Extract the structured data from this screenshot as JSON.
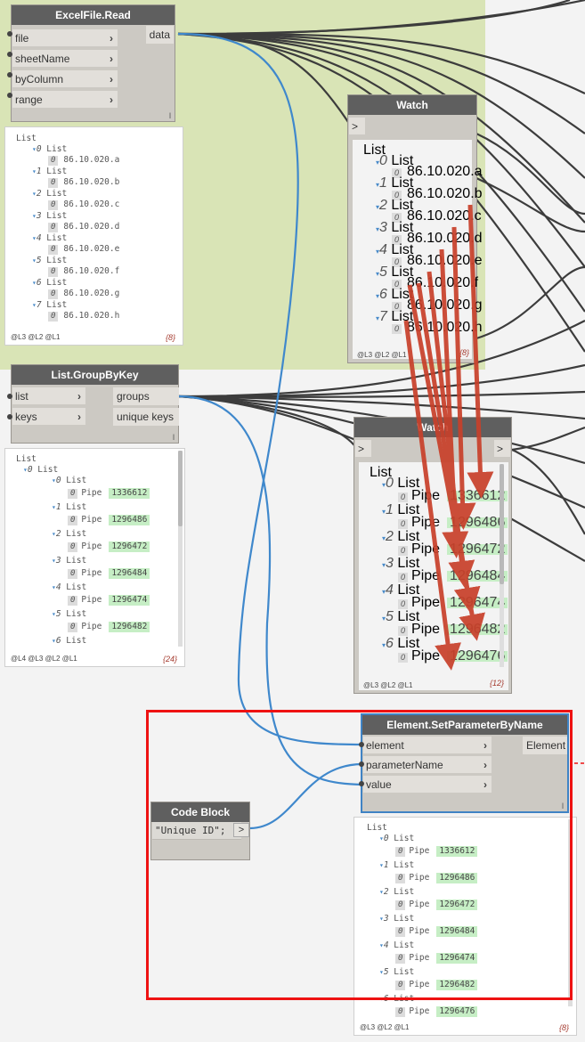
{
  "nodes": {
    "excel": {
      "title": "ExcelFile.Read",
      "inputs": [
        "file",
        "sheetName",
        "byColumn",
        "range"
      ],
      "output": "data",
      "lacing": "l"
    },
    "watch1": {
      "title": "Watch",
      "port": ">"
    },
    "group_by_key": {
      "title": "List.GroupByKey",
      "inputs": [
        "list",
        "keys"
      ],
      "outputs": [
        "groups",
        "unique keys"
      ],
      "lacing": "l"
    },
    "watch2": {
      "title": "Watch",
      "in_port": ">",
      "out_port": ">"
    },
    "set_param": {
      "title": "Element.SetParameterByName",
      "inputs": [
        "element",
        "parameterName",
        "value"
      ],
      "output": "Element",
      "lacing": "l"
    },
    "code_block": {
      "title": "Code Block",
      "code": "\"Unique ID\";",
      "out_port": ">"
    }
  },
  "previews": {
    "excel": {
      "root": "List",
      "items": [
        {
          "index": "0",
          "label": "List",
          "sub": "0",
          "value": "86.10.020.a"
        },
        {
          "index": "1",
          "label": "List",
          "sub": "0",
          "value": "86.10.020.b"
        },
        {
          "index": "2",
          "label": "List",
          "sub": "0",
          "value": "86.10.020.c"
        },
        {
          "index": "3",
          "label": "List",
          "sub": "0",
          "value": "86.10.020.d"
        },
        {
          "index": "4",
          "label": "List",
          "sub": "0",
          "value": "86.10.020.e"
        },
        {
          "index": "5",
          "label": "List",
          "sub": "0",
          "value": "86.10.020.f"
        },
        {
          "index": "6",
          "label": "List",
          "sub": "0",
          "value": "86.10.020.g"
        },
        {
          "index": "7",
          "label": "List",
          "sub": "0",
          "value": "86.10.020.h"
        }
      ],
      "levels": "@L3 @L2 @L1",
      "count": "{8}"
    },
    "watch1": {
      "root": "List",
      "items": [
        {
          "index": "0",
          "label": "List",
          "sub": "0",
          "value": "86.10.020.a"
        },
        {
          "index": "1",
          "label": "List",
          "sub": "0",
          "value": "86.10.020.b"
        },
        {
          "index": "2",
          "label": "List",
          "sub": "0",
          "value": "86.10.020.c"
        },
        {
          "index": "3",
          "label": "List",
          "sub": "0",
          "value": "86.10.020.d"
        },
        {
          "index": "4",
          "label": "List",
          "sub": "0",
          "value": "86.10.020.e"
        },
        {
          "index": "5",
          "label": "List",
          "sub": "0",
          "value": "86.10.020.f"
        },
        {
          "index": "6",
          "label": "List",
          "sub": "0",
          "value": "86.10.020.g"
        },
        {
          "index": "7",
          "label": "List",
          "sub": "0",
          "value": "86.10.020.h"
        }
      ],
      "levels": "@L3 @L2 @L1",
      "count": "{8}"
    },
    "group": {
      "root": "List",
      "sub_root_index": "0",
      "sub_root_label": "List",
      "items": [
        {
          "index": "0",
          "label": "List",
          "sub": "0",
          "text": "Pipe",
          "value": "1336612"
        },
        {
          "index": "1",
          "label": "List",
          "sub": "0",
          "text": "Pipe",
          "value": "1296486"
        },
        {
          "index": "2",
          "label": "List",
          "sub": "0",
          "text": "Pipe",
          "value": "1296472"
        },
        {
          "index": "3",
          "label": "List",
          "sub": "0",
          "text": "Pipe",
          "value": "1296484"
        },
        {
          "index": "4",
          "label": "List",
          "sub": "0",
          "text": "Pipe",
          "value": "1296474"
        },
        {
          "index": "5",
          "label": "List",
          "sub": "0",
          "text": "Pipe",
          "value": "1296482"
        },
        {
          "index": "6",
          "label": "List"
        }
      ],
      "levels": "@L4 @L3 @L2 @L1",
      "count": "{24}"
    },
    "watch2": {
      "root": "List",
      "items": [
        {
          "index": "0",
          "label": "List",
          "sub": "0",
          "text": "Pipe",
          "value": "1336612"
        },
        {
          "index": "1",
          "label": "List",
          "sub": "0",
          "text": "Pipe",
          "value": "1296486"
        },
        {
          "index": "2",
          "label": "List",
          "sub": "0",
          "text": "Pipe",
          "value": "1296472"
        },
        {
          "index": "3",
          "label": "List",
          "sub": "0",
          "text": "Pipe",
          "value": "1296484"
        },
        {
          "index": "4",
          "label": "List",
          "sub": "0",
          "text": "Pipe",
          "value": "1296474"
        },
        {
          "index": "5",
          "label": "List",
          "sub": "0",
          "text": "Pipe",
          "value": "1296482"
        },
        {
          "index": "6",
          "label": "List",
          "sub": "0",
          "text": "Pipe",
          "value": "1296476"
        }
      ],
      "levels": "@L3 @L2 @L1",
      "count": "{12}"
    },
    "set_param": {
      "root": "List",
      "items": [
        {
          "index": "0",
          "label": "List",
          "sub": "0",
          "text": "Pipe",
          "value": "1336612"
        },
        {
          "index": "1",
          "label": "List",
          "sub": "0",
          "text": "Pipe",
          "value": "1296486"
        },
        {
          "index": "2",
          "label": "List",
          "sub": "0",
          "text": "Pipe",
          "value": "1296472"
        },
        {
          "index": "3",
          "label": "List",
          "sub": "0",
          "text": "Pipe",
          "value": "1296484"
        },
        {
          "index": "4",
          "label": "List",
          "sub": "0",
          "text": "Pipe",
          "value": "1296474"
        },
        {
          "index": "5",
          "label": "List",
          "sub": "0",
          "text": "Pipe",
          "value": "1296482"
        },
        {
          "index": "6",
          "label": "List",
          "sub": "0",
          "text": "Pipe",
          "value": "1296476"
        }
      ],
      "levels": "@L3 @L2 @L1",
      "count": "{8}"
    }
  },
  "colors": {
    "group_background": "#d9e4b6",
    "wire_blue": "#3f88cc",
    "wire_dark": "#3c3c3c",
    "annotation_arrow": "#c8402a",
    "highlight_box": "#ee1212",
    "value_badge": "#c6eec5"
  },
  "annotations": {
    "highlight": "red-rectangle",
    "arrows": "red-arrows"
  }
}
